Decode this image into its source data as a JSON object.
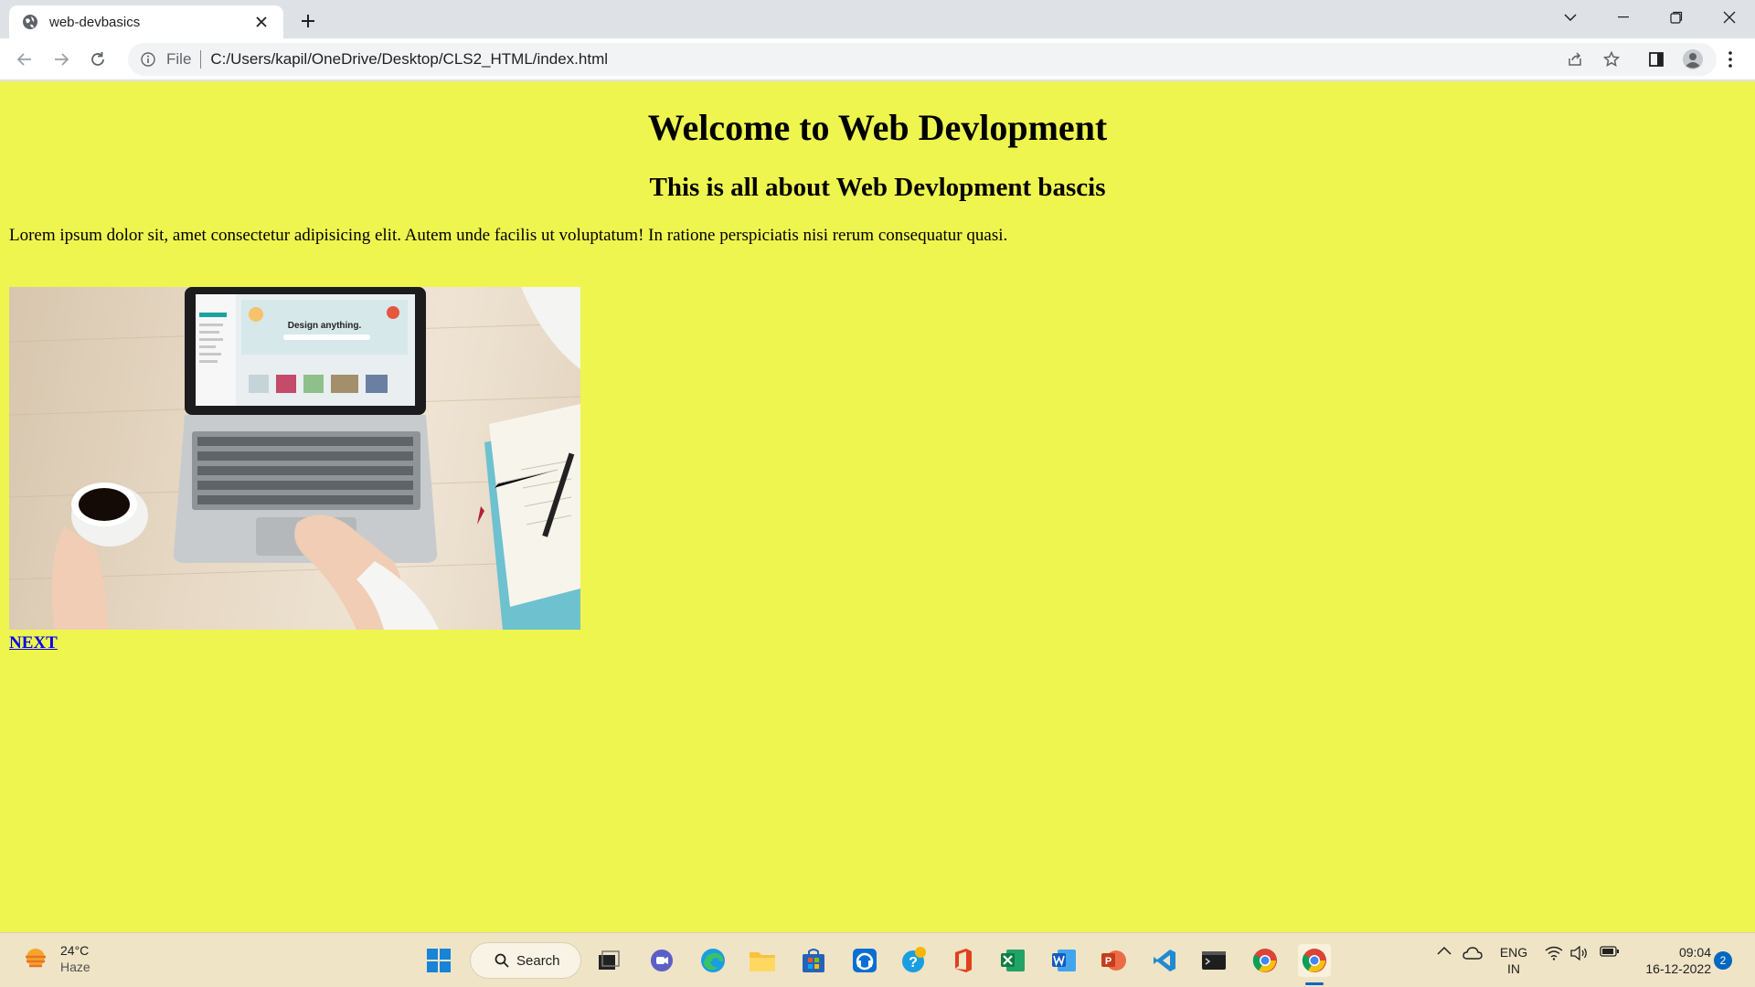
{
  "browser": {
    "tab_title": "web-devbasics",
    "file_label": "File",
    "url": "C:/Users/kapil/OneDrive/Desktop/CLS2_HTML/index.html"
  },
  "page": {
    "heading": "Welcome to Web Devlopment",
    "subheading": "This is all about Web Devlopment bascis",
    "paragraph": "Lorem ipsum dolor sit, amet consectetur adipisicing elit. Autem unde facilis ut voluptatum! In ratione perspiciatis nisi rerum consequatur quasi.",
    "link_text": "NEXT",
    "background_color": "#eef54f",
    "laptop_screen_text": "Design anything."
  },
  "taskbar": {
    "weather_temp": "24°C",
    "weather_condition": "Haze",
    "search_label": "Search",
    "lang_line1": "ENG",
    "lang_line2": "IN",
    "time": "09:04",
    "date": "16-12-2022",
    "notification_count": "2"
  }
}
